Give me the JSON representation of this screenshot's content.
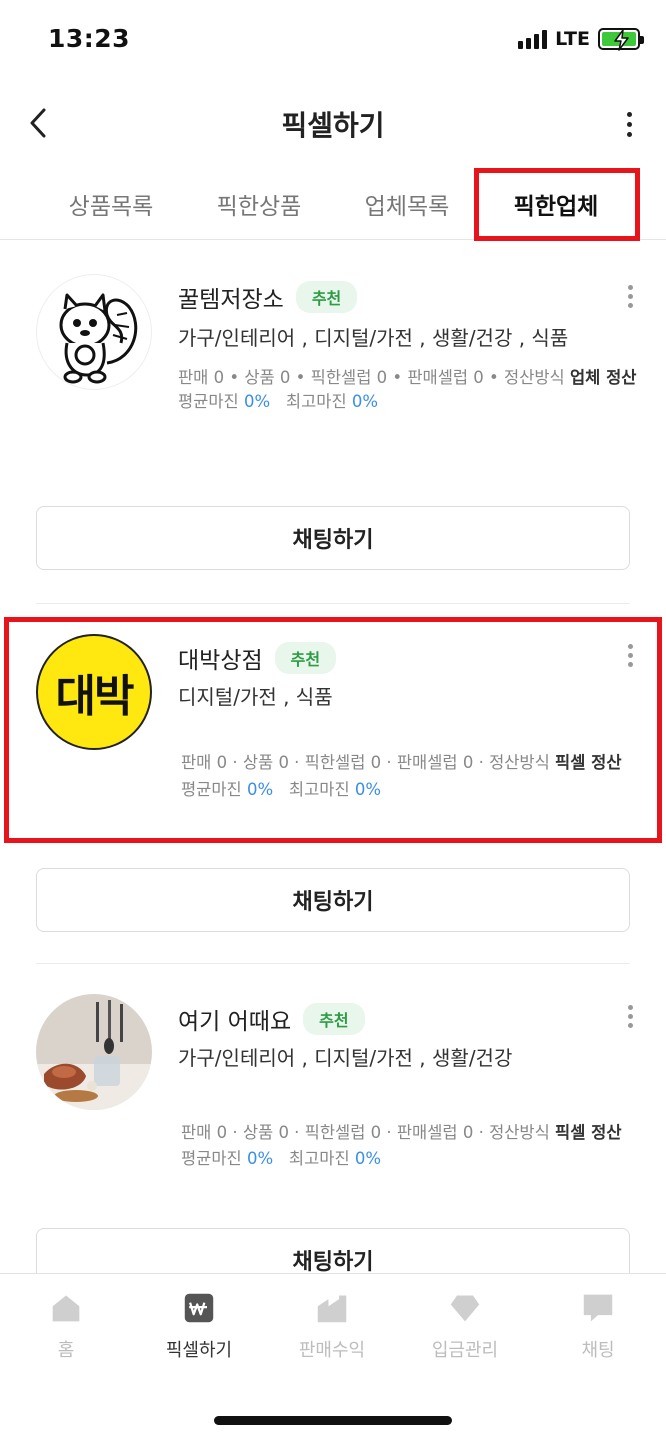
{
  "status_bar": {
    "time": "13:23",
    "network": "LTE"
  },
  "header": {
    "title": "픽셀하기"
  },
  "tabs": [
    {
      "label": "상품목록",
      "active": false
    },
    {
      "label": "픽한상품",
      "active": false
    },
    {
      "label": "업체목록",
      "active": false
    },
    {
      "label": "픽한업체",
      "active": true
    }
  ],
  "vendors": [
    {
      "name": "꿀템저장소",
      "badge": "추천",
      "categories": "가구/인테리어 , 디지털/가전 , 생활/건강 , 식품",
      "stats_line": "판매 0 • 상품 0 • 픽한셀럽 0 • 판매셀럽 0 • 정산방식",
      "settlement": "업체 정산",
      "avg_margin_label": "평균마진",
      "avg_margin": "0%",
      "max_margin_label": "최고마진",
      "max_margin": "0%",
      "chat_label": "채팅하기",
      "logo_icon": "squirrel-logo-icon"
    },
    {
      "name": "대박상점",
      "badge": "추천",
      "categories": "디지털/가전 , 식품",
      "stats_line": "판매 0 · 상품 0 · 픽한셀럽 0 · 판매셀럽 0 · 정산방식",
      "settlement": "픽셀 정산",
      "avg_margin_label": "평균마진",
      "avg_margin": "0%",
      "max_margin_label": "최고마진",
      "max_margin": "0%",
      "chat_label": "채팅하기",
      "logo_text": "대박"
    },
    {
      "name": "여기 어때요",
      "badge": "추천",
      "categories": "가구/인테리어 , 디지털/가전 , 생활/건강",
      "stats_line": "판매 0 · 상품 0 · 픽한셀럽 0 · 판매셀럽 0 · 정산방식",
      "settlement": "픽셀 정산",
      "avg_margin_label": "평균마진",
      "avg_margin": "0%",
      "max_margin_label": "최고마진",
      "max_margin": "0%",
      "chat_label": "채팅하기",
      "logo_icon": "kitchen-photo-icon"
    }
  ],
  "bottom_nav": [
    {
      "label": "홈",
      "icon": "home-icon",
      "active": false
    },
    {
      "label": "픽셀하기",
      "icon": "pixel-won-icon",
      "active": true
    },
    {
      "label": "판매수익",
      "icon": "factory-icon",
      "active": false
    },
    {
      "label": "입금관리",
      "icon": "diamond-icon",
      "active": false
    },
    {
      "label": "채팅",
      "icon": "chat-bubble-icon",
      "active": false
    }
  ],
  "colors": {
    "highlight": "#e8141c",
    "badge_green": "#2e9b45",
    "margin_blue": "#3b8ee8"
  }
}
